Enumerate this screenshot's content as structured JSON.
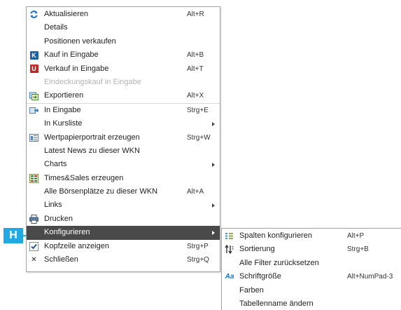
{
  "main_menu": {
    "items": [
      {
        "label": "Aktualisieren",
        "shortcut": "Alt+R",
        "icon": "refresh-icon"
      },
      {
        "label": "Details",
        "shortcut": ""
      },
      {
        "label": "Positionen verkaufen",
        "shortcut": ""
      },
      {
        "label": "Kauf in Eingabe",
        "shortcut": "Alt+B",
        "icon": "buy-k-icon",
        "icon_glyph": "K"
      },
      {
        "label": "Verkauf in Eingabe",
        "shortcut": "Alt+T",
        "icon": "sell-u-icon",
        "icon_glyph": "U"
      },
      {
        "label": "Eindeckungskauf in Eingabe",
        "shortcut": "",
        "disabled": true
      },
      {
        "label": "Exportieren",
        "shortcut": "Alt+X",
        "icon": "export-icon"
      },
      {
        "label": "In Eingabe",
        "shortcut": "Strg+E",
        "icon": "input-icon"
      },
      {
        "label": "In Kursliste",
        "shortcut": "",
        "submenu": true
      },
      {
        "label": "Wertpapierportrait erzeugen",
        "shortcut": "Strg+W",
        "icon": "portrait-icon"
      },
      {
        "label": "Latest News zu dieser WKN",
        "shortcut": ""
      },
      {
        "label": "Charts",
        "shortcut": "",
        "submenu": true
      },
      {
        "label": "Times&Sales erzeugen",
        "shortcut": "",
        "icon": "times-sales-icon"
      },
      {
        "label": "Alle Börsenplätze zu dieser WKN",
        "shortcut": "Alt+A"
      },
      {
        "label": "Links",
        "shortcut": "",
        "submenu": true
      },
      {
        "label": "Drucken",
        "shortcut": "",
        "icon": "print-icon"
      },
      {
        "label": "Konfigurieren",
        "shortcut": "",
        "submenu": true,
        "highlighted": true
      },
      {
        "label": "Kopfzeile anzeigen",
        "shortcut": "Strg+P",
        "icon": "checkbox-checked-icon"
      },
      {
        "label": "Schließen",
        "shortcut": "Strg+Q",
        "icon": "close-icon",
        "icon_glyph": "✕"
      }
    ]
  },
  "sub_menu": {
    "items": [
      {
        "label": "Spalten konfigurieren",
        "shortcut": "Alt+P",
        "icon": "columns-config-icon"
      },
      {
        "label": "Sortierung",
        "shortcut": "Strg+B",
        "icon": "sort-icon"
      },
      {
        "label": "Alle Filter zurücksetzen",
        "shortcut": ""
      },
      {
        "label": "Schriftgröße",
        "shortcut": "Alt+NumPad-3",
        "icon": "font-size-icon",
        "icon_glyph": "Aa"
      },
      {
        "label": "Farben",
        "shortcut": ""
      },
      {
        "label": "Tabellenname ändern",
        "shortcut": ""
      }
    ]
  },
  "callout": {
    "letter": "H"
  },
  "colors": {
    "highlight": "#4a4a4a",
    "callout": "#22a9e1",
    "disabled_text": "#b4b4b4"
  }
}
